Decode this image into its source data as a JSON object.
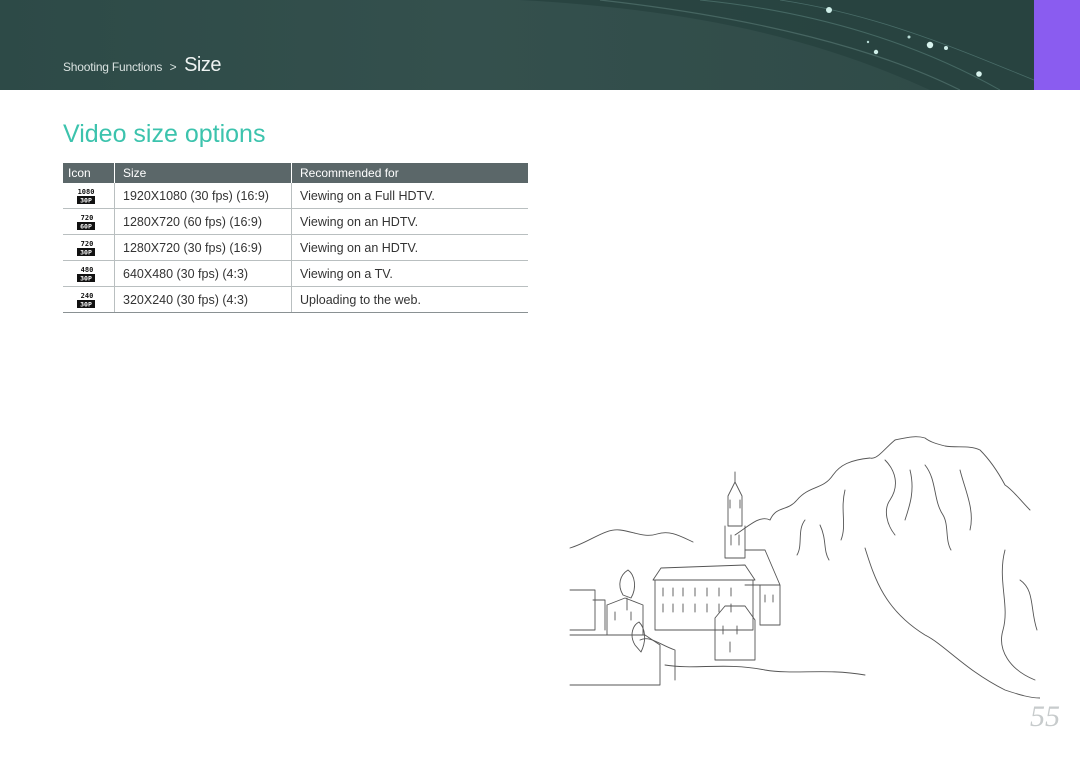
{
  "header": {
    "breadcrumb_parent": "Shooting Functions",
    "breadcrumb_separator": ">",
    "breadcrumb_current": "Size",
    "accent_color": "#8a5cf0",
    "banner_color": "#2d4a47"
  },
  "page_title": "Video size options",
  "title_color": "#3cc3ad",
  "table": {
    "headers": [
      "Icon",
      "Size",
      "Recommended for"
    ],
    "rows": [
      {
        "icon_top": "1080",
        "icon_bottom": "30P",
        "size": "1920X1080 (30 fps) (16:9)",
        "recommended": "Viewing on a Full HDTV."
      },
      {
        "icon_top": "720",
        "icon_bottom": "60P",
        "size": "1280X720 (60 fps) (16:9)",
        "recommended": "Viewing on an HDTV."
      },
      {
        "icon_top": "720",
        "icon_bottom": "30P",
        "size": "1280X720 (30 fps) (16:9)",
        "recommended": "Viewing on an HDTV."
      },
      {
        "icon_top": "480",
        "icon_bottom": "30P",
        "size": "640X480 (30 fps) (4:3)",
        "recommended": "Viewing on a TV."
      },
      {
        "icon_top": "240",
        "icon_bottom": "30P",
        "size": "320X240 (30 fps) (4:3)",
        "recommended": "Uploading to the web."
      }
    ]
  },
  "page_number": "55"
}
